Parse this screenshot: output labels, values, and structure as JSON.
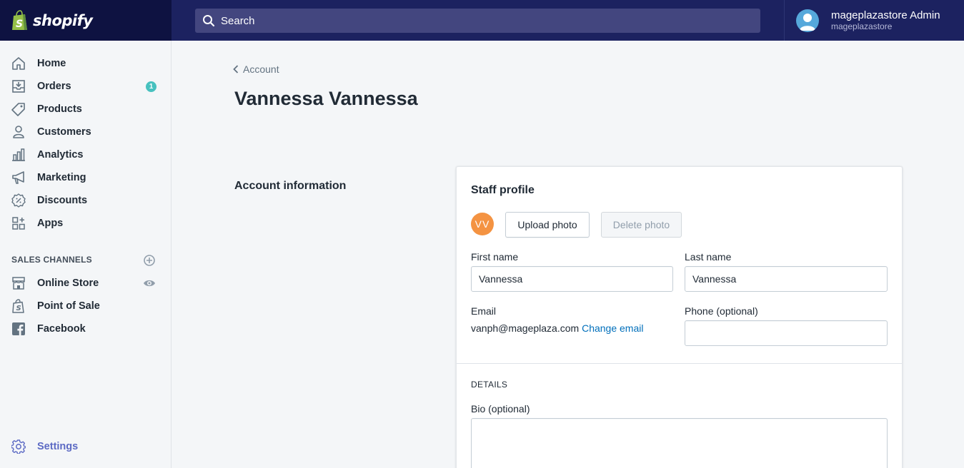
{
  "header": {
    "logo_text": "shopify",
    "search_placeholder": "Search",
    "user_name": "mageplazastore Admin",
    "user_store": "mageplazastore"
  },
  "sidebar": {
    "items": [
      {
        "label": "Home",
        "icon": "home-icon"
      },
      {
        "label": "Orders",
        "icon": "orders-icon",
        "badge": "1"
      },
      {
        "label": "Products",
        "icon": "tag-icon"
      },
      {
        "label": "Customers",
        "icon": "person-icon"
      },
      {
        "label": "Analytics",
        "icon": "bar-chart-icon"
      },
      {
        "label": "Marketing",
        "icon": "megaphone-icon"
      },
      {
        "label": "Discounts",
        "icon": "discount-icon"
      },
      {
        "label": "Apps",
        "icon": "apps-icon"
      }
    ],
    "sales_channels_title": "SALES CHANNELS",
    "channels": [
      {
        "label": "Online Store",
        "icon": "store-icon"
      },
      {
        "label": "Point of Sale",
        "icon": "pos-bag-icon"
      },
      {
        "label": "Facebook",
        "icon": "facebook-icon"
      }
    ],
    "settings_label": "Settings"
  },
  "main": {
    "breadcrumb": "Account",
    "page_title": "Vannessa Vannessa",
    "section_label": "Account information",
    "card": {
      "title": "Staff profile",
      "avatar_initials": "VV",
      "upload_label": "Upload photo",
      "delete_label": "Delete photo",
      "first_name_label": "First name",
      "first_name_value": "Vannessa",
      "last_name_label": "Last name",
      "last_name_value": "Vannessa",
      "email_label": "Email",
      "email_value": "vanph@mageplaza.com",
      "change_email_label": "Change email",
      "phone_label": "Phone (optional)",
      "phone_value": "",
      "details_title": "DETAILS",
      "bio_label": "Bio (optional)",
      "bio_value": ""
    }
  },
  "colors": {
    "topbar": "#1c2260",
    "logo_bg": "#0e1241",
    "accent": "#5c6ac4",
    "badge": "#47c1bf",
    "avatar": "#f49342",
    "link": "#006fbb"
  }
}
